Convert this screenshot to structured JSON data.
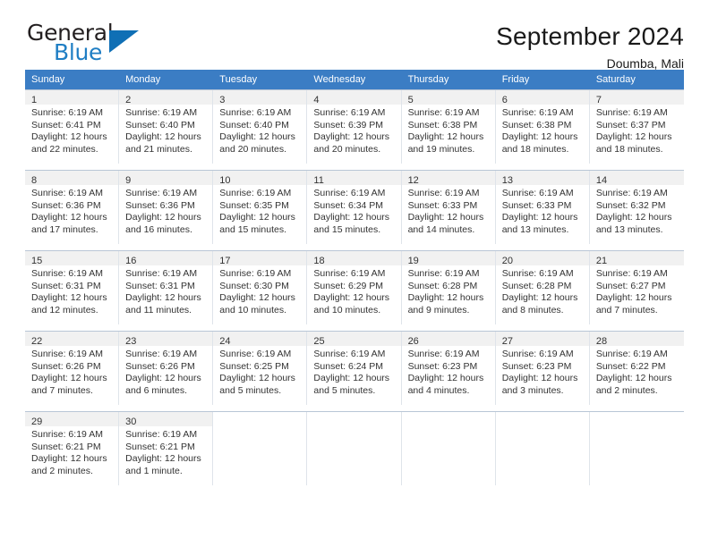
{
  "brand": {
    "name_top": "General",
    "name_bottom": "Blue",
    "accent_color": "#1f7ec4",
    "triangle_color": "#0f6fb5"
  },
  "header": {
    "title": "September 2024",
    "subtitle": "Doumba, Mali"
  },
  "calendar": {
    "header_bg": "#3b7dc4",
    "day_band_bg": "#f1f1f1",
    "weekdays": [
      "Sunday",
      "Monday",
      "Tuesday",
      "Wednesday",
      "Thursday",
      "Friday",
      "Saturday"
    ],
    "weeks": [
      [
        {
          "day": "1",
          "sunrise": "Sunrise: 6:19 AM",
          "sunset": "Sunset: 6:41 PM",
          "daylight_line1": "Daylight: 12 hours",
          "daylight_line2": "and 22 minutes."
        },
        {
          "day": "2",
          "sunrise": "Sunrise: 6:19 AM",
          "sunset": "Sunset: 6:40 PM",
          "daylight_line1": "Daylight: 12 hours",
          "daylight_line2": "and 21 minutes."
        },
        {
          "day": "3",
          "sunrise": "Sunrise: 6:19 AM",
          "sunset": "Sunset: 6:40 PM",
          "daylight_line1": "Daylight: 12 hours",
          "daylight_line2": "and 20 minutes."
        },
        {
          "day": "4",
          "sunrise": "Sunrise: 6:19 AM",
          "sunset": "Sunset: 6:39 PM",
          "daylight_line1": "Daylight: 12 hours",
          "daylight_line2": "and 20 minutes."
        },
        {
          "day": "5",
          "sunrise": "Sunrise: 6:19 AM",
          "sunset": "Sunset: 6:38 PM",
          "daylight_line1": "Daylight: 12 hours",
          "daylight_line2": "and 19 minutes."
        },
        {
          "day": "6",
          "sunrise": "Sunrise: 6:19 AM",
          "sunset": "Sunset: 6:38 PM",
          "daylight_line1": "Daylight: 12 hours",
          "daylight_line2": "and 18 minutes."
        },
        {
          "day": "7",
          "sunrise": "Sunrise: 6:19 AM",
          "sunset": "Sunset: 6:37 PM",
          "daylight_line1": "Daylight: 12 hours",
          "daylight_line2": "and 18 minutes."
        }
      ],
      [
        {
          "day": "8",
          "sunrise": "Sunrise: 6:19 AM",
          "sunset": "Sunset: 6:36 PM",
          "daylight_line1": "Daylight: 12 hours",
          "daylight_line2": "and 17 minutes."
        },
        {
          "day": "9",
          "sunrise": "Sunrise: 6:19 AM",
          "sunset": "Sunset: 6:36 PM",
          "daylight_line1": "Daylight: 12 hours",
          "daylight_line2": "and 16 minutes."
        },
        {
          "day": "10",
          "sunrise": "Sunrise: 6:19 AM",
          "sunset": "Sunset: 6:35 PM",
          "daylight_line1": "Daylight: 12 hours",
          "daylight_line2": "and 15 minutes."
        },
        {
          "day": "11",
          "sunrise": "Sunrise: 6:19 AM",
          "sunset": "Sunset: 6:34 PM",
          "daylight_line1": "Daylight: 12 hours",
          "daylight_line2": "and 15 minutes."
        },
        {
          "day": "12",
          "sunrise": "Sunrise: 6:19 AM",
          "sunset": "Sunset: 6:33 PM",
          "daylight_line1": "Daylight: 12 hours",
          "daylight_line2": "and 14 minutes."
        },
        {
          "day": "13",
          "sunrise": "Sunrise: 6:19 AM",
          "sunset": "Sunset: 6:33 PM",
          "daylight_line1": "Daylight: 12 hours",
          "daylight_line2": "and 13 minutes."
        },
        {
          "day": "14",
          "sunrise": "Sunrise: 6:19 AM",
          "sunset": "Sunset: 6:32 PM",
          "daylight_line1": "Daylight: 12 hours",
          "daylight_line2": "and 13 minutes."
        }
      ],
      [
        {
          "day": "15",
          "sunrise": "Sunrise: 6:19 AM",
          "sunset": "Sunset: 6:31 PM",
          "daylight_line1": "Daylight: 12 hours",
          "daylight_line2": "and 12 minutes."
        },
        {
          "day": "16",
          "sunrise": "Sunrise: 6:19 AM",
          "sunset": "Sunset: 6:31 PM",
          "daylight_line1": "Daylight: 12 hours",
          "daylight_line2": "and 11 minutes."
        },
        {
          "day": "17",
          "sunrise": "Sunrise: 6:19 AM",
          "sunset": "Sunset: 6:30 PM",
          "daylight_line1": "Daylight: 12 hours",
          "daylight_line2": "and 10 minutes."
        },
        {
          "day": "18",
          "sunrise": "Sunrise: 6:19 AM",
          "sunset": "Sunset: 6:29 PM",
          "daylight_line1": "Daylight: 12 hours",
          "daylight_line2": "and 10 minutes."
        },
        {
          "day": "19",
          "sunrise": "Sunrise: 6:19 AM",
          "sunset": "Sunset: 6:28 PM",
          "daylight_line1": "Daylight: 12 hours",
          "daylight_line2": "and 9 minutes."
        },
        {
          "day": "20",
          "sunrise": "Sunrise: 6:19 AM",
          "sunset": "Sunset: 6:28 PM",
          "daylight_line1": "Daylight: 12 hours",
          "daylight_line2": "and 8 minutes."
        },
        {
          "day": "21",
          "sunrise": "Sunrise: 6:19 AM",
          "sunset": "Sunset: 6:27 PM",
          "daylight_line1": "Daylight: 12 hours",
          "daylight_line2": "and 7 minutes."
        }
      ],
      [
        {
          "day": "22",
          "sunrise": "Sunrise: 6:19 AM",
          "sunset": "Sunset: 6:26 PM",
          "daylight_line1": "Daylight: 12 hours",
          "daylight_line2": "and 7 minutes."
        },
        {
          "day": "23",
          "sunrise": "Sunrise: 6:19 AM",
          "sunset": "Sunset: 6:26 PM",
          "daylight_line1": "Daylight: 12 hours",
          "daylight_line2": "and 6 minutes."
        },
        {
          "day": "24",
          "sunrise": "Sunrise: 6:19 AM",
          "sunset": "Sunset: 6:25 PM",
          "daylight_line1": "Daylight: 12 hours",
          "daylight_line2": "and 5 minutes."
        },
        {
          "day": "25",
          "sunrise": "Sunrise: 6:19 AM",
          "sunset": "Sunset: 6:24 PM",
          "daylight_line1": "Daylight: 12 hours",
          "daylight_line2": "and 5 minutes."
        },
        {
          "day": "26",
          "sunrise": "Sunrise: 6:19 AM",
          "sunset": "Sunset: 6:23 PM",
          "daylight_line1": "Daylight: 12 hours",
          "daylight_line2": "and 4 minutes."
        },
        {
          "day": "27",
          "sunrise": "Sunrise: 6:19 AM",
          "sunset": "Sunset: 6:23 PM",
          "daylight_line1": "Daylight: 12 hours",
          "daylight_line2": "and 3 minutes."
        },
        {
          "day": "28",
          "sunrise": "Sunrise: 6:19 AM",
          "sunset": "Sunset: 6:22 PM",
          "daylight_line1": "Daylight: 12 hours",
          "daylight_line2": "and 2 minutes."
        }
      ],
      [
        {
          "day": "29",
          "sunrise": "Sunrise: 6:19 AM",
          "sunset": "Sunset: 6:21 PM",
          "daylight_line1": "Daylight: 12 hours",
          "daylight_line2": "and 2 minutes."
        },
        {
          "day": "30",
          "sunrise": "Sunrise: 6:19 AM",
          "sunset": "Sunset: 6:21 PM",
          "daylight_line1": "Daylight: 12 hours",
          "daylight_line2": "and 1 minute."
        },
        {
          "day": "",
          "sunrise": "",
          "sunset": "",
          "daylight_line1": "",
          "daylight_line2": ""
        },
        {
          "day": "",
          "sunrise": "",
          "sunset": "",
          "daylight_line1": "",
          "daylight_line2": ""
        },
        {
          "day": "",
          "sunrise": "",
          "sunset": "",
          "daylight_line1": "",
          "daylight_line2": ""
        },
        {
          "day": "",
          "sunrise": "",
          "sunset": "",
          "daylight_line1": "",
          "daylight_line2": ""
        },
        {
          "day": "",
          "sunrise": "",
          "sunset": "",
          "daylight_line1": "",
          "daylight_line2": ""
        }
      ]
    ]
  }
}
